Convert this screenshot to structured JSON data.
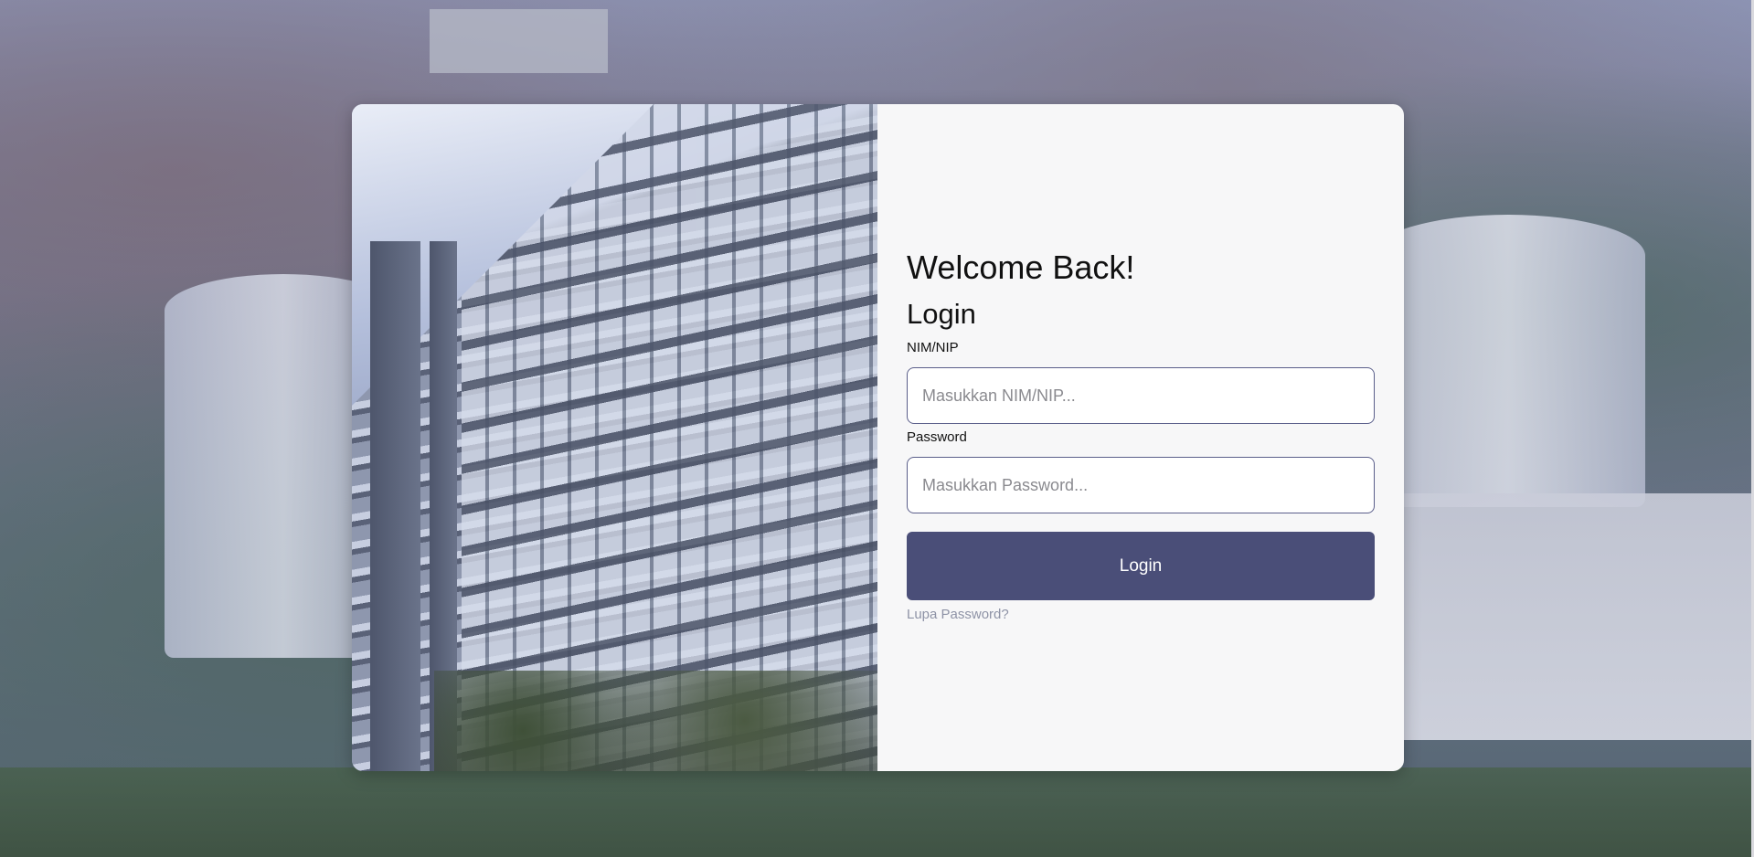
{
  "page": {
    "background_image": "campus-aerial-photo",
    "card_image": "building-facade-photo"
  },
  "login_form": {
    "welcome_title": "Welcome Back!",
    "heading": "Login",
    "nim_label": "NIM/NIP",
    "nim_placeholder": "Masukkan NIM/NIP...",
    "nim_value": "",
    "password_label": "Password",
    "password_placeholder": "Masukkan Password...",
    "password_value": "",
    "submit_label": "Login",
    "forgot_password_label": "Lupa Password?"
  },
  "colors": {
    "primary_button": "#4a4e78",
    "input_border": "#5a5e8a",
    "panel_background": "#f7f7f8",
    "link_muted": "#8e93a6"
  }
}
